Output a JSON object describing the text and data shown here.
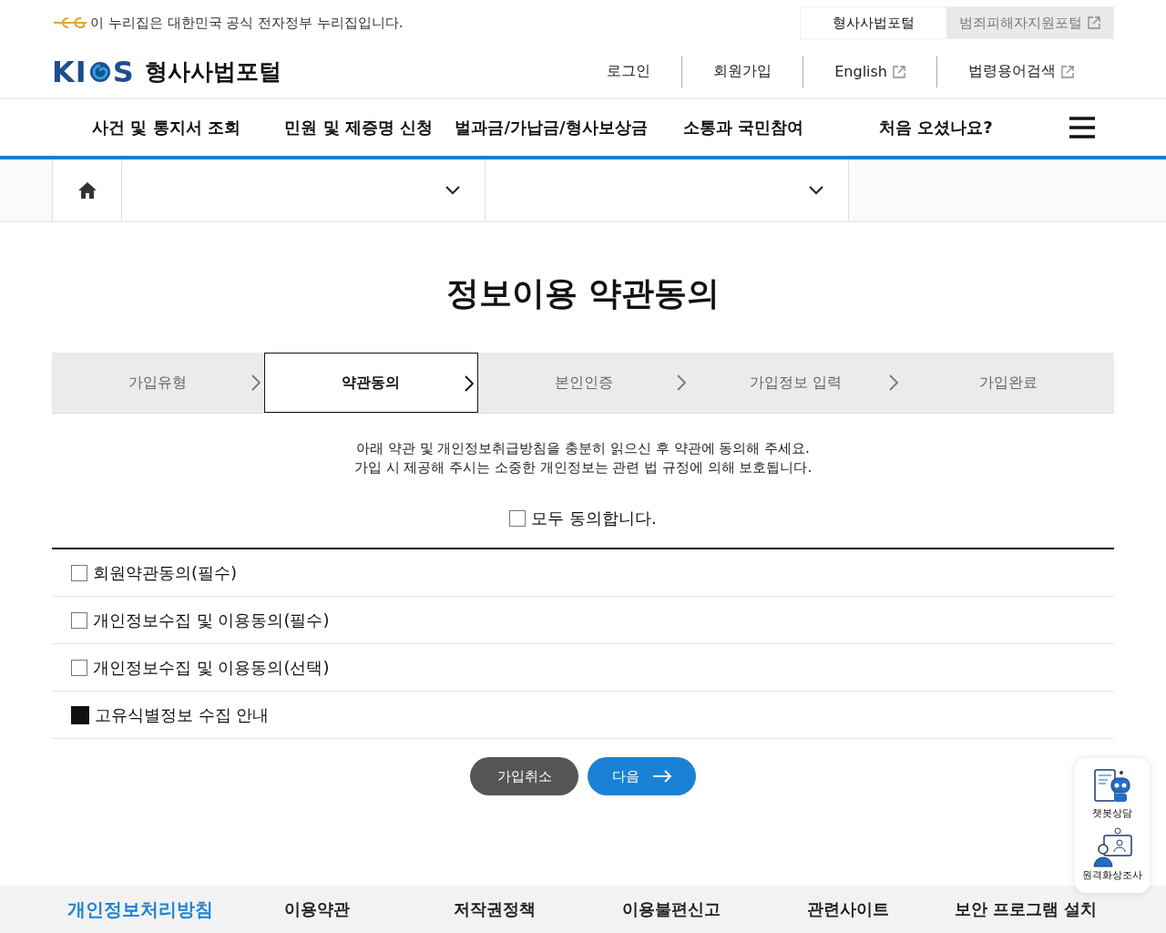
{
  "gov_banner": {
    "text": "이 누리집은 대한민국 공식 전자정부 누리집입니다."
  },
  "portal_tabs": [
    {
      "label": "형사사법포털",
      "selected": true,
      "external": false
    },
    {
      "label": "범죄피해자지원포털",
      "selected": false,
      "external": true
    }
  ],
  "logo": {
    "mark_left": "KI",
    "mark_right": "S",
    "name": "형사사법포털"
  },
  "util_links": [
    {
      "label": "로그인",
      "external": false
    },
    {
      "label": "회원가입",
      "external": false
    },
    {
      "label": "English",
      "external": true
    },
    {
      "label": "법령용어검색",
      "external": true
    }
  ],
  "main_nav": [
    "사건 및 통지서 조회",
    "민원 및 제증명 신청",
    "벌과금/가납금/형사보상금",
    "소통과 국민참여",
    "처음 오셨나요?"
  ],
  "page_title": "정보이용 약관동의",
  "steps": [
    {
      "label": "가입유형",
      "selected": false
    },
    {
      "label": "약관동의",
      "selected": true
    },
    {
      "label": "본인인증",
      "selected": false
    },
    {
      "label": "가입정보 입력",
      "selected": false
    },
    {
      "label": "가입완료",
      "selected": false
    }
  ],
  "intro": [
    "아래 약관 및 개인정보취급방침을 충분히 읽으신 후 약관에 동의해 주세요.",
    "가입 시 제공해 주시는 소중한 개인정보는 관련 법 규정에 의해 보호됩니다."
  ],
  "agree_all": {
    "label": "모두 동의합니다.",
    "checked": false
  },
  "terms": [
    {
      "kind": "checkbox",
      "label": "회원약관동의(필수)",
      "checked": false
    },
    {
      "kind": "checkbox",
      "label": "개인정보수집 및 이용동의(필수)",
      "checked": false
    },
    {
      "kind": "checkbox",
      "label": "개인정보수집 및 이용동의(선택)",
      "checked": false
    },
    {
      "kind": "notice",
      "label": "고유식별정보 수집 안내"
    }
  ],
  "buttons": [
    {
      "label": "가입취소",
      "kind": "cancel"
    },
    {
      "label": "다음",
      "kind": "next"
    }
  ],
  "quick_menu": [
    {
      "label": "챗봇상담",
      "kind": "chatbot"
    },
    {
      "label": "원격화상조사",
      "kind": "video"
    }
  ],
  "footer_links": [
    {
      "label": "개인정보처리방침",
      "emphasis": true
    },
    {
      "label": "이용약관",
      "emphasis": false
    },
    {
      "label": "저작권정책",
      "emphasis": false
    },
    {
      "label": "이용불편신고",
      "emphasis": false
    },
    {
      "label": "관련사이트",
      "emphasis": false
    },
    {
      "label": "보안 프로그램 설치",
      "emphasis": false
    }
  ]
}
